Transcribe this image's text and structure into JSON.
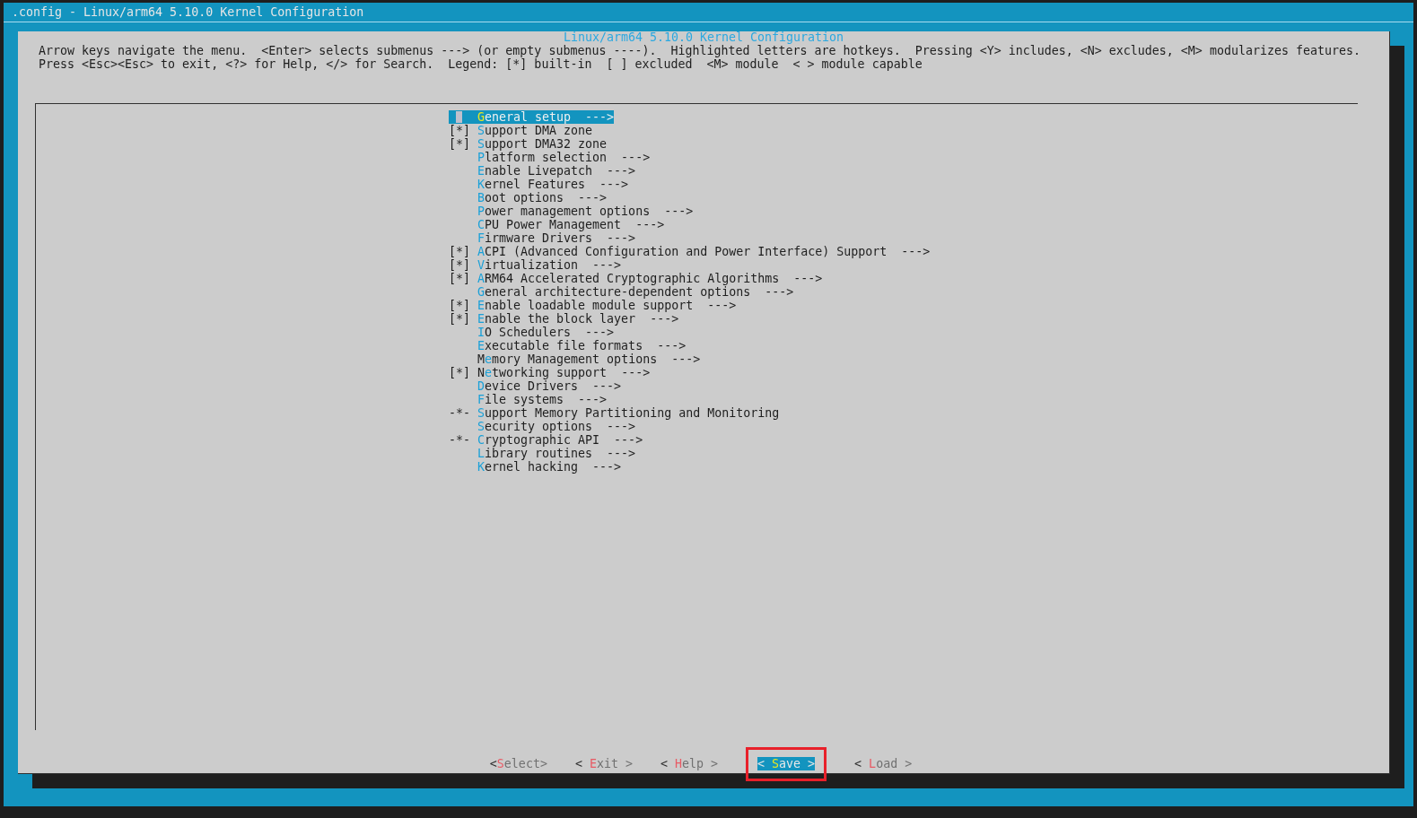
{
  "window": {
    "title": ".config - Linux/arm64 5.10.0 Kernel Configuration"
  },
  "dialog": {
    "title": "Linux/arm64 5.10.0 Kernel Configuration",
    "help_lines": [
      "Arrow keys navigate the menu.  <Enter> selects submenus ---> (or empty submenus ----).  Highlighted letters are hotkeys.  Pressing <Y> includes, <N> excludes, <M> modularizes features.",
      "Press <Esc><Esc> to exit, <?> for Help, </> for Search.  Legend: [*] built-in  [ ] excluded  <M> module  < > module capable"
    ]
  },
  "menu": [
    {
      "hotkey": "G",
      "rest": "eneral setup  --->",
      "selected": true
    },
    {
      "prefix": "[*]",
      "hotkey": "S",
      "rest": "upport DMA zone",
      "selected": false
    },
    {
      "prefix": "[*]",
      "hotkey": "S",
      "rest": "upport DMA32 zone",
      "selected": false
    },
    {
      "hotkey": "P",
      "rest": "latform selection  --->",
      "selected": false
    },
    {
      "hotkey": "E",
      "rest": "nable Livepatch  --->",
      "selected": false
    },
    {
      "hotkey": "K",
      "rest": "ernel Features  --->",
      "selected": false
    },
    {
      "hotkey": "B",
      "rest": "oot options  --->",
      "selected": false
    },
    {
      "hotkey": "P",
      "rest": "ower management options  --->",
      "selected": false
    },
    {
      "hotkey": "C",
      "rest": "PU Power Management  --->",
      "selected": false
    },
    {
      "hotkey": "F",
      "rest": "irmware Drivers  --->",
      "selected": false
    },
    {
      "prefix": "[*]",
      "hotkey": "A",
      "rest": "CPI (Advanced Configuration and Power Interface) Support  --->",
      "selected": false
    },
    {
      "prefix": "[*]",
      "hotkey": "V",
      "rest": "irtualization  --->",
      "selected": false
    },
    {
      "prefix": "[*]",
      "hotkey": "A",
      "rest": "RM64 Accelerated Cryptographic Algorithms  --->",
      "selected": false
    },
    {
      "hotkey": "G",
      "rest": "eneral architecture-dependent options  --->",
      "selected": false
    },
    {
      "prefix": "[*]",
      "hotkey": "E",
      "rest": "nable loadable module support  --->",
      "selected": false
    },
    {
      "prefix": "[*]",
      "hotkey": "E",
      "rest": "nable the block layer  --->",
      "selected": false
    },
    {
      "hotkey": "I",
      "rest": "O Schedulers  --->",
      "selected": false
    },
    {
      "hotkey": "E",
      "rest": "xecutable file formats  --->",
      "selected": false
    },
    {
      "lead": "M",
      "hotkey": "e",
      "rest": "mory Management options  --->",
      "selected": false
    },
    {
      "prefix": "[*]",
      "lead": "N",
      "hotkey": "e",
      "rest": "tworking support  --->",
      "selected": false
    },
    {
      "hotkey": "D",
      "rest": "evice Drivers  --->",
      "selected": false
    },
    {
      "hotkey": "F",
      "rest": "ile systems  --->",
      "selected": false
    },
    {
      "prefix": "-*-",
      "hotkey": "S",
      "rest": "upport Memory Partitioning and Monitoring",
      "selected": false
    },
    {
      "hotkey": "S",
      "rest": "ecurity options  --->",
      "selected": false
    },
    {
      "prefix": "-*-",
      "hotkey": "C",
      "rest": "ryptographic API  --->",
      "selected": false
    },
    {
      "hotkey": "L",
      "rest": "ibrary routines  --->",
      "selected": false
    },
    {
      "hotkey": "K",
      "rest": "ernel hacking  --->",
      "selected": false
    }
  ],
  "buttons": [
    {
      "lead": "<",
      "hotkey": "S",
      "rest": "elect>",
      "selected": false,
      "annotated": false
    },
    {
      "lead": "< ",
      "hotkey": "E",
      "rest": "xit >",
      "selected": false,
      "annotated": false
    },
    {
      "lead": "< ",
      "hotkey": "H",
      "rest": "elp >",
      "selected": false,
      "annotated": false
    },
    {
      "lead": "< ",
      "hotkey": "S",
      "rest": "ave >",
      "selected": true,
      "annotated": true
    },
    {
      "lead": "< ",
      "hotkey": "L",
      "rest": "oad >",
      "selected": false,
      "annotated": false
    }
  ]
}
